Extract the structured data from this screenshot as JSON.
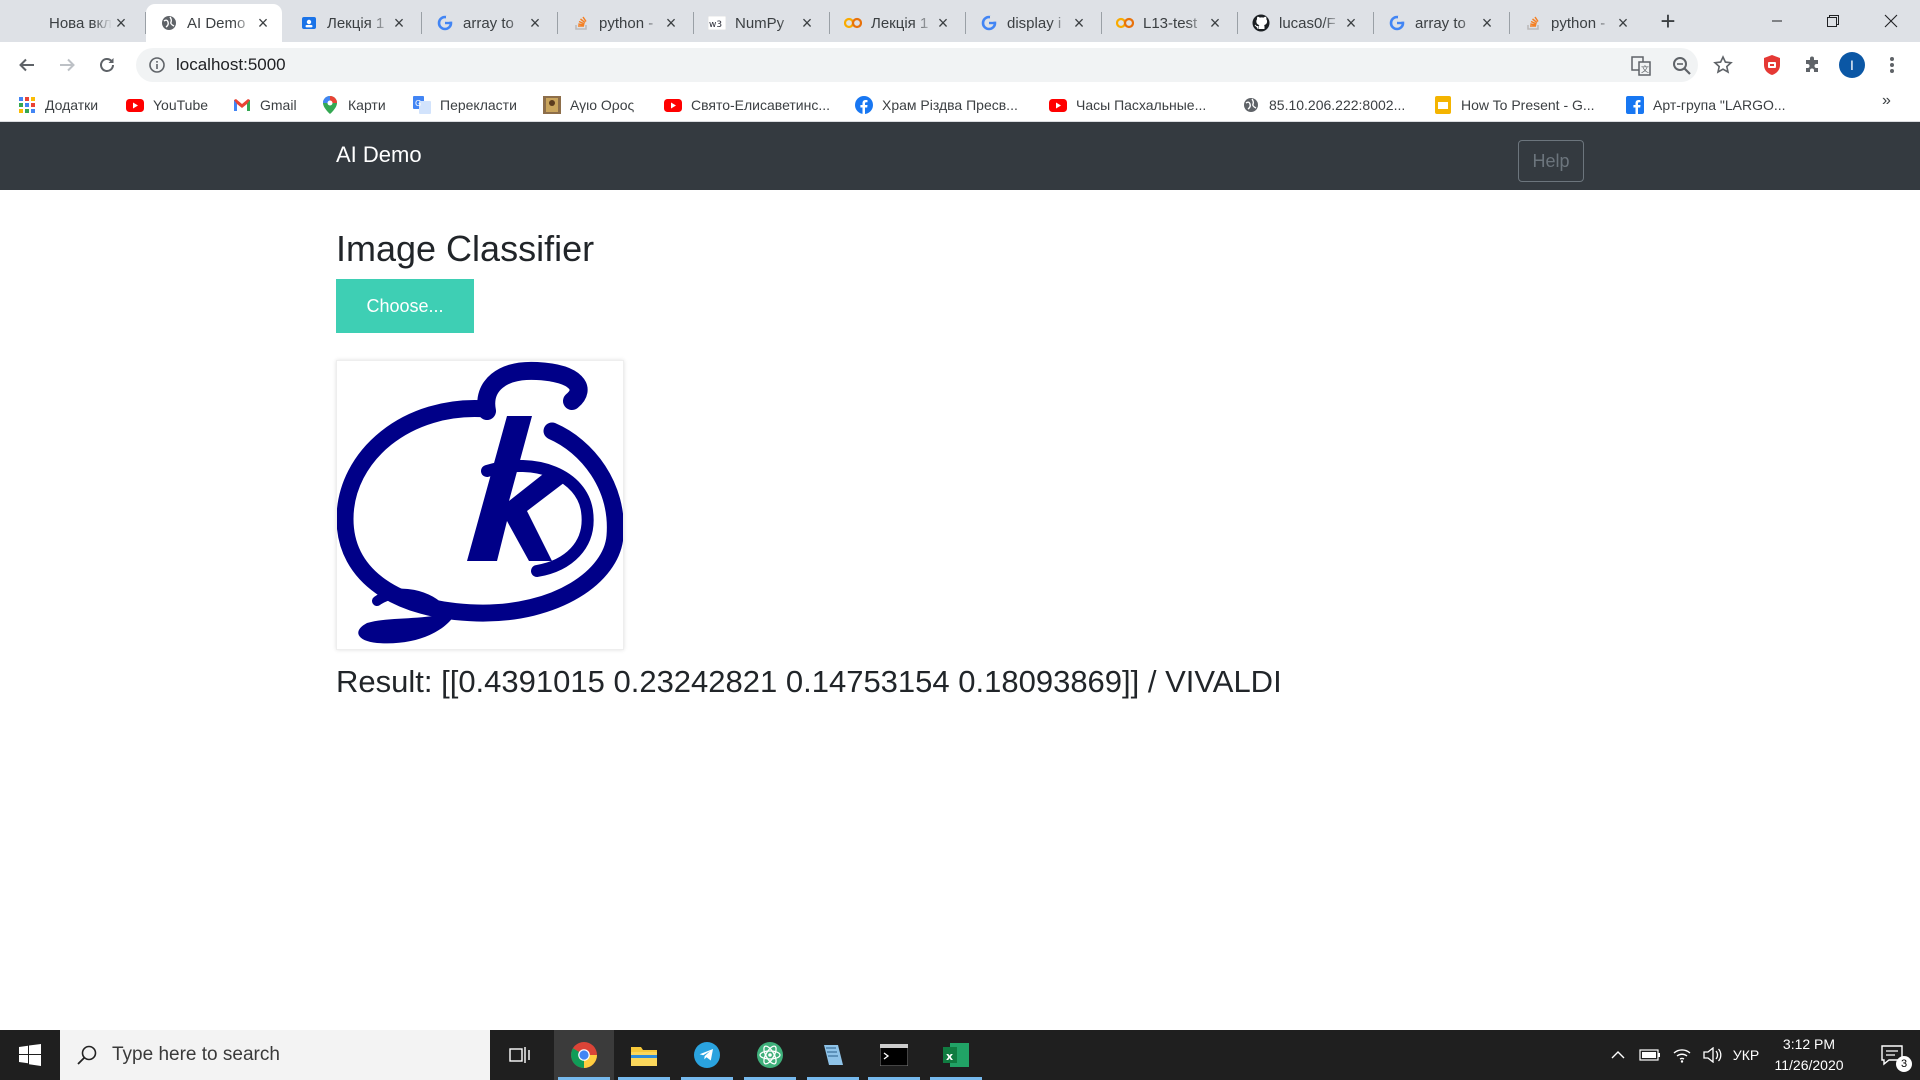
{
  "browser": {
    "tabs": [
      {
        "title": "Нова вкладка",
        "icon": "new-tab-page-icon"
      },
      {
        "title": "AI Demo",
        "icon": "globe-icon",
        "active": true
      },
      {
        "title": "Лекція 1",
        "icon": "classroom-icon"
      },
      {
        "title": "array to",
        "icon": "google-icon"
      },
      {
        "title": "python -",
        "icon": "stackoverflow-icon"
      },
      {
        "title": "NumPy",
        "icon": "w3schools-icon"
      },
      {
        "title": "Лекція 1",
        "icon": "colab-icon"
      },
      {
        "title": "display i",
        "icon": "google-icon"
      },
      {
        "title": "L13-test",
        "icon": "colab-icon"
      },
      {
        "title": "lucas0/F",
        "icon": "github-icon"
      },
      {
        "title": "array to",
        "icon": "google-icon"
      },
      {
        "title": "python -",
        "icon": "stackoverflow-icon"
      }
    ],
    "url": "localhost:5000",
    "bookmarks": [
      {
        "label": "Додатки",
        "icon": "apps-grid-icon"
      },
      {
        "label": "YouTube",
        "icon": "youtube-icon"
      },
      {
        "label": "Gmail",
        "icon": "gmail-icon"
      },
      {
        "label": "Карти",
        "icon": "maps-pin-icon"
      },
      {
        "label": "Перекласти",
        "icon": "translate-icon"
      },
      {
        "label": "Αγιο Ορος",
        "icon": "icon-image-icon"
      },
      {
        "label": "Свято-Елисаветинс...",
        "icon": "youtube-icon"
      },
      {
        "label": "Храм Різдва Пресв...",
        "icon": "facebook-icon"
      },
      {
        "label": "Часы Пасхальные...",
        "icon": "youtube-icon"
      },
      {
        "label": "85.10.206.222:8002...",
        "icon": "globe-icon"
      },
      {
        "label": "How To Present - G...",
        "icon": "slides-icon"
      },
      {
        "label": "Арт-група \"LARGO...",
        "icon": "facebook-icon"
      }
    ],
    "profile_initial": "I",
    "more_bookmarks": "»"
  },
  "app": {
    "brand": "AI Demo",
    "help_label": "Help",
    "title": "Image Classifier",
    "choose_label": "Choose...",
    "result_text": "Result: [[0.4391015 0.23242821 0.14753154 0.18093869]] / VIVALDI",
    "accent_color": "#3ecfb4",
    "navbar_color": "#343a40"
  },
  "taskbar": {
    "search_placeholder": "Type here to search",
    "time": "3:12 PM",
    "date": "11/26/2020",
    "language": "УКР",
    "notification_count": "3",
    "apps": [
      "task-view-icon",
      "chrome-icon",
      "file-explorer-icon",
      "telegram-icon",
      "atom-icon",
      "notepad-icon",
      "terminal-icon",
      "excel-icon"
    ]
  }
}
